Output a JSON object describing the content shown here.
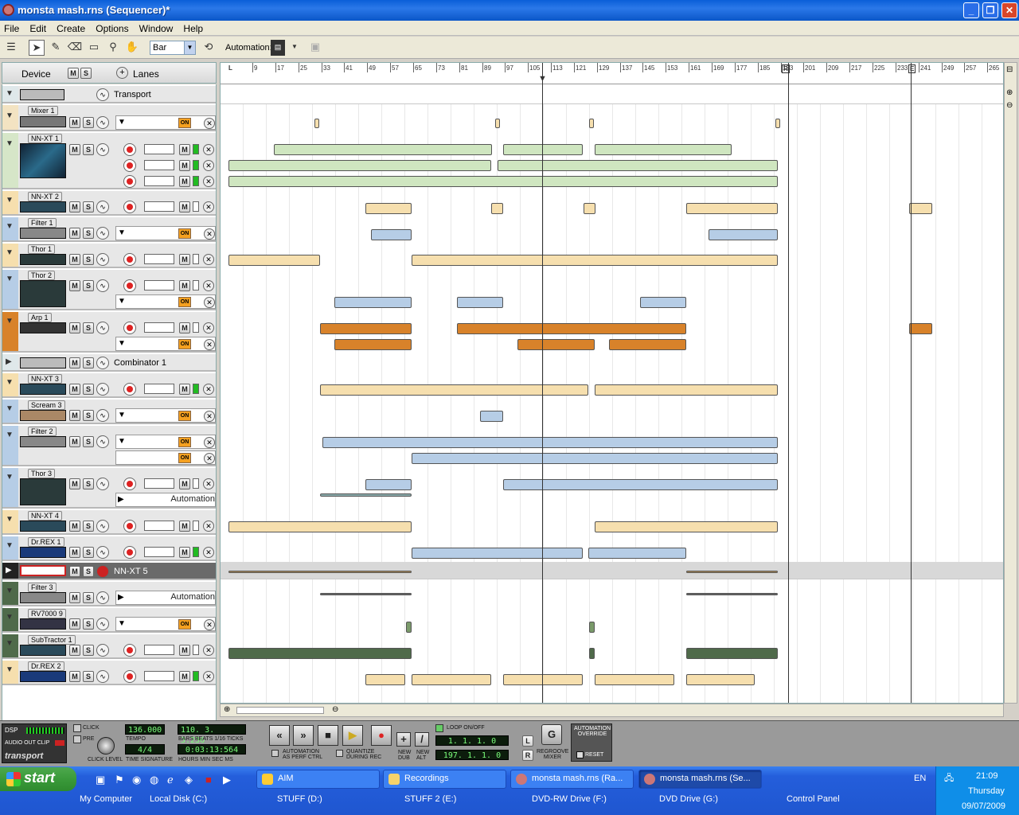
{
  "window": {
    "title": "monsta mash.rns (Sequencer)*"
  },
  "menu": [
    "File",
    "Edit",
    "Create",
    "Options",
    "Window",
    "Help"
  ],
  "toolbar": {
    "snap_value": "Bar",
    "automation_label": "Automation:"
  },
  "trackheader": {
    "device": "Device",
    "m": "M",
    "s": "S",
    "lanes": "Lanes"
  },
  "ruler": {
    "bars": [
      "9",
      "17",
      "25",
      "33",
      "41",
      "49",
      "57",
      "65",
      "73",
      "81",
      "89",
      "97",
      "105",
      "113",
      "121",
      "129",
      "137",
      "145",
      "153",
      "161",
      "169",
      "177",
      "185",
      "193",
      "201",
      "209",
      "217",
      "225",
      "233",
      "241",
      "249",
      "257",
      "265"
    ],
    "left_marker": "L",
    "right_marker": "R",
    "end_marker": "E"
  },
  "tracks": [
    {
      "name": "Transport",
      "label": "Transport"
    },
    {
      "name": "Mixer 1",
      "on": "ON"
    },
    {
      "name": "NN-XT 1"
    },
    {
      "name": "NN-XT 2"
    },
    {
      "name": "Filter 1",
      "on": "ON"
    },
    {
      "name": "Thor 1"
    },
    {
      "name": "Thor 2",
      "on": "ON"
    },
    {
      "name": "Arp 1",
      "on": "ON"
    },
    {
      "name": "Combinator 1",
      "label": "Combinator 1"
    },
    {
      "name": "NN-XT 3"
    },
    {
      "name": "Scream 3",
      "on": "ON"
    },
    {
      "name": "Filter 2",
      "on": "ON",
      "on2": "ON"
    },
    {
      "name": "Thor 3",
      "automation": "Automation"
    },
    {
      "name": "NN-XT 4"
    },
    {
      "name": "Dr.REX 1"
    },
    {
      "name": "NN-XT 5",
      "label": "NN-XT 5"
    },
    {
      "name": "Filter 3",
      "automation": "Automation"
    },
    {
      "name": "RV7000 9",
      "on": "ON"
    },
    {
      "name": "SubTractor 1"
    },
    {
      "name": "Dr.REX 2"
    }
  ],
  "transport": {
    "dsp": "DSP",
    "audio_out_clip": "AUDIO OUT CLIP",
    "brand": "transport",
    "click": "CLICK",
    "pre": "PRE",
    "click_level": "CLICK LEVEL",
    "tempo": "136.000",
    "tempo_label": "TEMPO",
    "time_signature": "4/4",
    "time_signature_label": "TIME SIGNATURE",
    "position_bars": "110. 3. 3.236",
    "bars_label": "BARS BEATS 1/16 TICKS",
    "position_time": "0:03:13:564",
    "time_label": "HOURS MIN SEC MS",
    "automation_perf": "AUTOMATION AS PERF CTRL",
    "quantize_rec": "QUANTIZE DURING REC",
    "new_dub": "NEW DUB",
    "new_alt": "NEW ALT",
    "loop_onoff": "LOOP ON/OFF",
    "left_locator": "1. 1. 1. 0",
    "right_locator": "197. 1. 1. 0",
    "l": "L",
    "r": "R",
    "regroove": "REGROOVE MIXER",
    "automation_override": "AUTOMATION OVERRIDE",
    "reset": "RESET"
  },
  "taskbar": {
    "start": "start",
    "tasks": [
      "AIM",
      "Recordings",
      "monsta mash.rns (Ra...",
      "monsta mash.rns (Se..."
    ],
    "quicklinks": [
      "My Computer",
      "Local Disk (C:)",
      "STUFF (D:)",
      "STUFF 2 (E:)",
      "DVD-RW Drive (F:)",
      "DVD Drive (G:)",
      "Control Panel"
    ],
    "lang": "EN",
    "time": "21:09",
    "day": "Thursday",
    "date": "09/07/2009"
  },
  "colors": {
    "xp_blue": "#245edb",
    "clip_green": "#cfe6c0",
    "clip_yellow": "#f6dfae",
    "clip_blue": "#b6cde6",
    "clip_orange": "#d8822a",
    "clip_dark_green": "#4f6a4a"
  }
}
